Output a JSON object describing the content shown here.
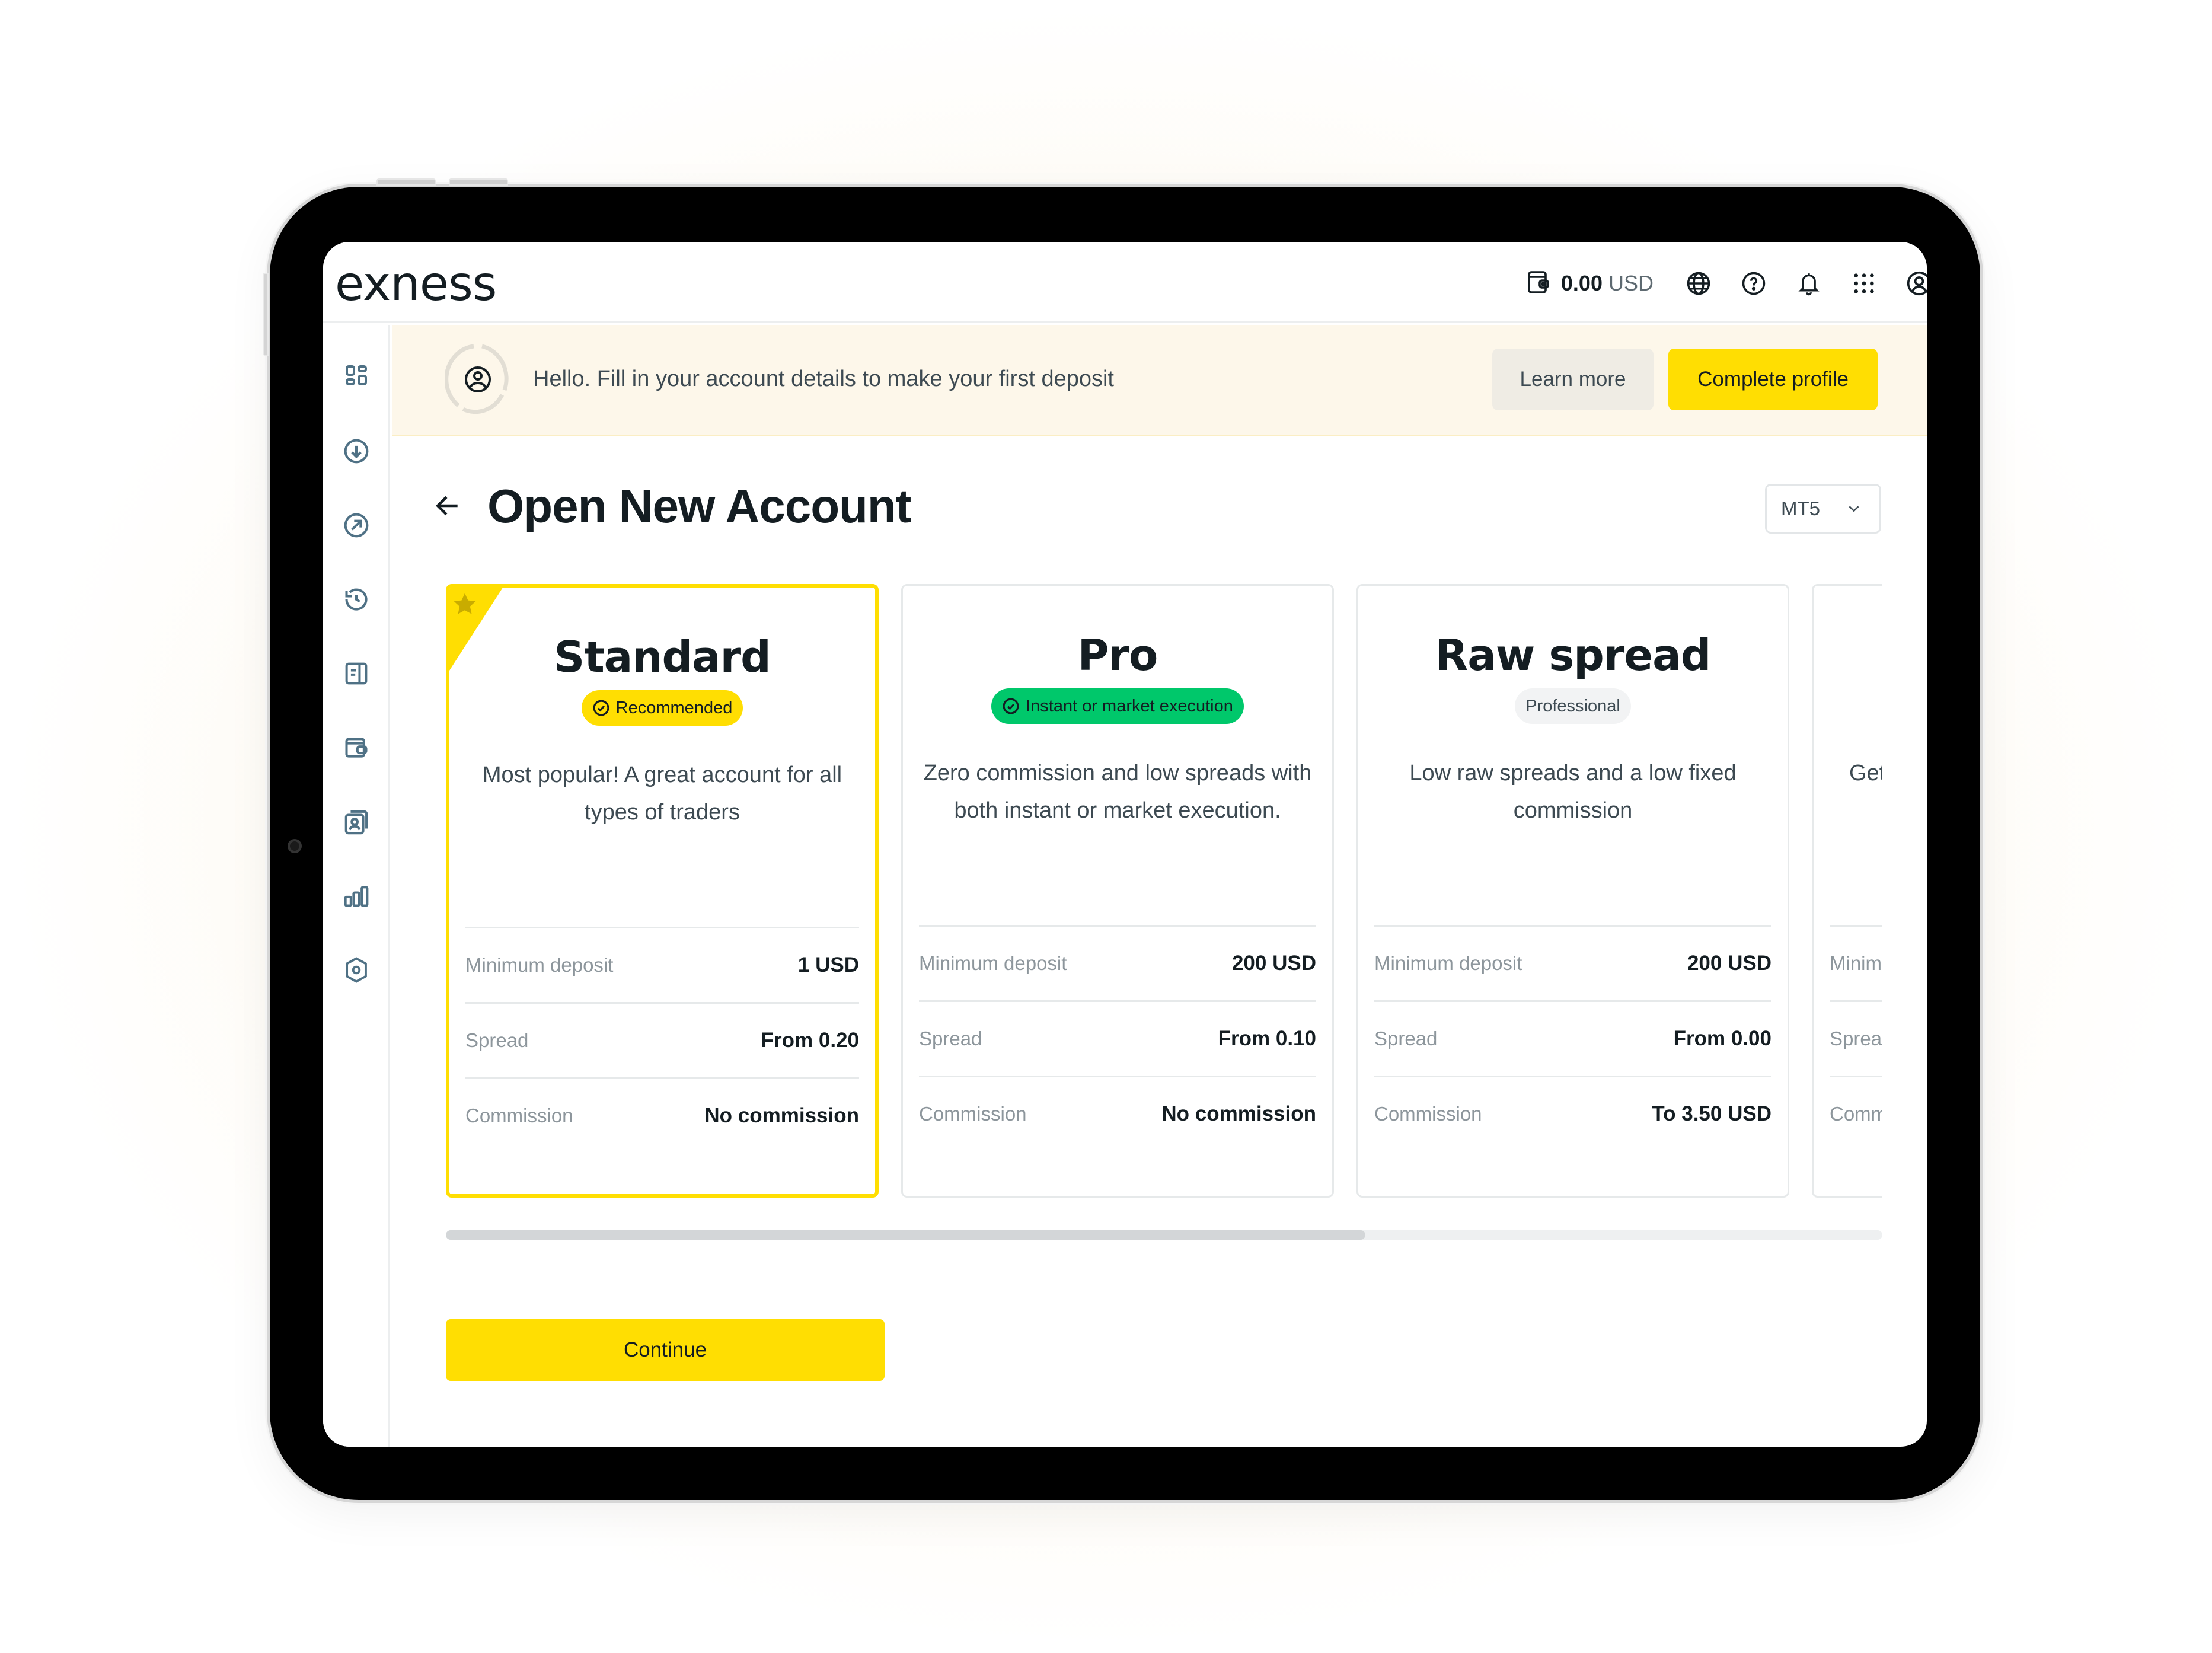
{
  "app": {
    "logo_text": "exness"
  },
  "header": {
    "balance_amount": "0.00",
    "balance_currency": "USD",
    "icons": [
      "wallet-icon",
      "globe-icon",
      "help-icon",
      "bell-icon",
      "apps-grid-icon",
      "profile-icon"
    ]
  },
  "sidebar": {
    "items": [
      {
        "icon": "dashboard-icon"
      },
      {
        "icon": "deposit-icon"
      },
      {
        "icon": "withdraw-icon"
      },
      {
        "icon": "history-icon"
      },
      {
        "icon": "document-icon"
      },
      {
        "icon": "wallet-icon"
      },
      {
        "icon": "copy-trading-icon"
      },
      {
        "icon": "analytics-icon"
      },
      {
        "icon": "security-icon"
      }
    ]
  },
  "banner": {
    "message": "Hello. Fill in your account details to make your first deposit",
    "learn_more_label": "Learn more",
    "complete_profile_label": "Complete profile"
  },
  "page": {
    "title": "Open New Account",
    "platform_selected": "MT5"
  },
  "accounts": [
    {
      "name": "Standard",
      "badge": "Recommended",
      "badge_style": "yellow",
      "description": "Most popular! A great account for all types of traders",
      "selected": true,
      "rows": [
        {
          "label": "Minimum deposit",
          "value": "1 USD"
        },
        {
          "label": "Spread",
          "value": "From 0.20"
        },
        {
          "label": "Commission",
          "value": "No commission"
        }
      ]
    },
    {
      "name": "Pro",
      "badge": "Instant or market execution",
      "badge_style": "green",
      "description": "Zero commission and low spreads with both instant or market execution.",
      "selected": false,
      "rows": [
        {
          "label": "Minimum deposit",
          "value": "200 USD"
        },
        {
          "label": "Spread",
          "value": "From 0.10"
        },
        {
          "label": "Commission",
          "value": "No commission"
        }
      ]
    },
    {
      "name": "Raw spread",
      "badge": "Professional",
      "badge_style": "grey",
      "description": "Low raw spreads and a low fixed commission",
      "selected": false,
      "rows": [
        {
          "label": "Minimum deposit",
          "value": "200 USD"
        },
        {
          "label": "Spread",
          "value": "From 0.00"
        },
        {
          "label": "Commission",
          "value": "To 3.50 USD"
        }
      ]
    },
    {
      "name": "",
      "badge": "",
      "description": "Get",
      "selected": false,
      "rows": [
        {
          "label": "Minim",
          "value": ""
        },
        {
          "label": "Sprea",
          "value": ""
        },
        {
          "label": "Comm",
          "value": ""
        }
      ]
    }
  ],
  "carousel": {
    "scroll_position_fraction": 0.64
  },
  "footer": {
    "continue_label": "Continue"
  },
  "colors": {
    "brand_yellow": "#ffde02",
    "success_green": "#00c86b",
    "text_primary": "#141d22",
    "banner_bg": "#fdf7ea"
  }
}
